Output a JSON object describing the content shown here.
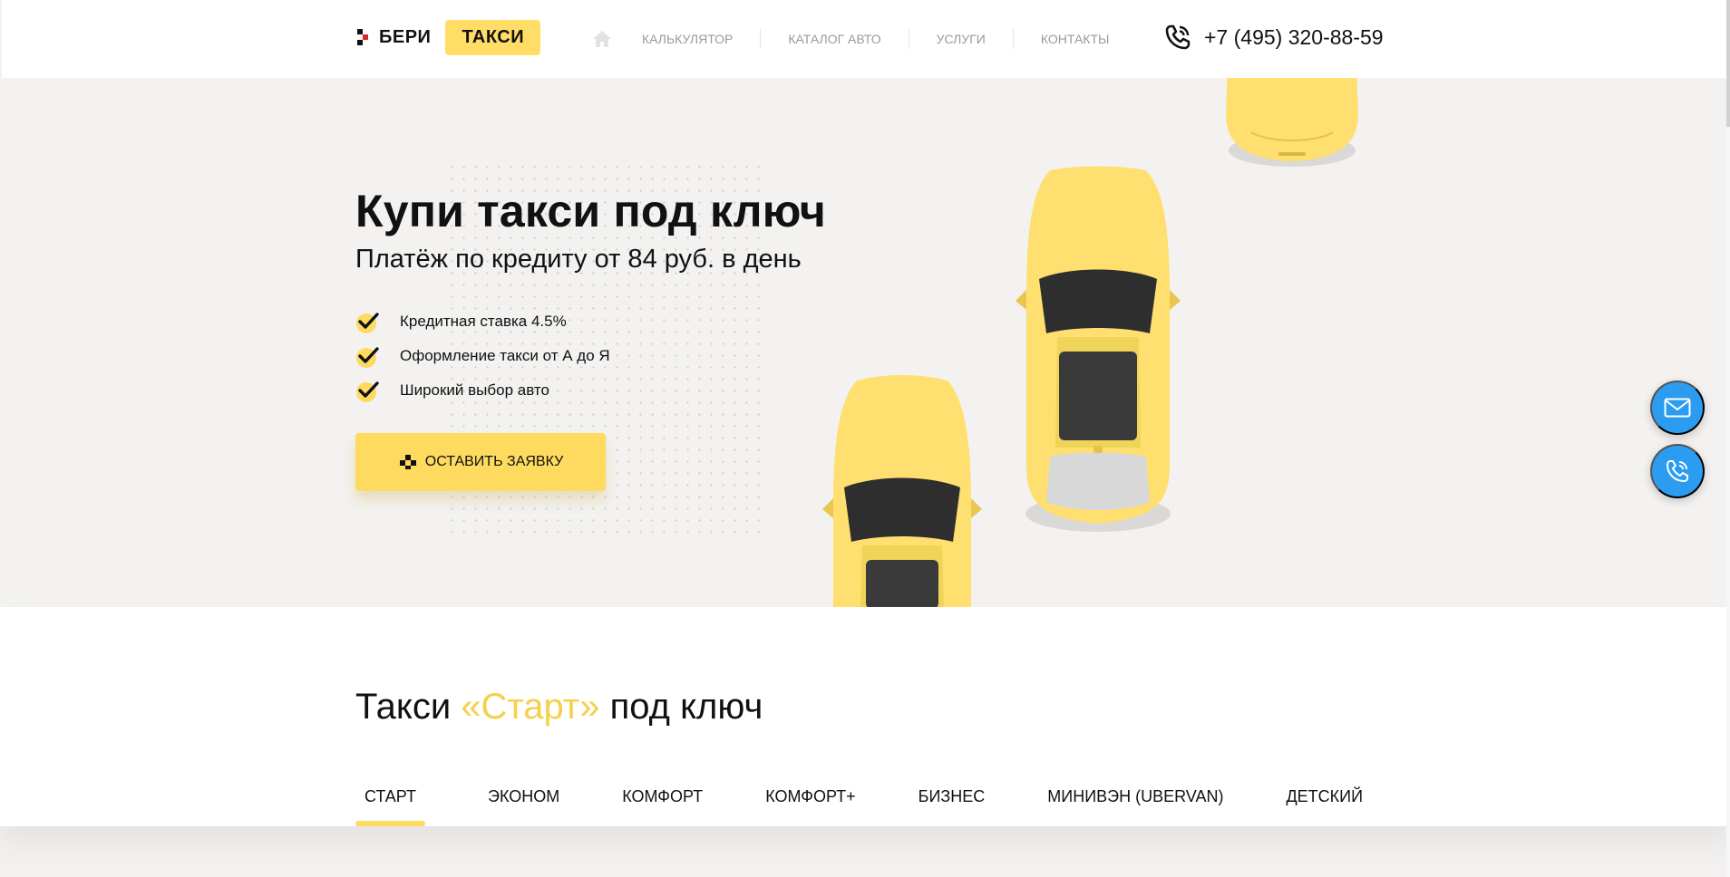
{
  "header": {
    "logo": {
      "left": "БЕРИ",
      "right": "ТАКСИ"
    },
    "nav": [
      {
        "label": "КАЛЬКУЛЯТОР"
      },
      {
        "label": "КАТАЛОГ АВТО"
      },
      {
        "label": "УСЛУГИ"
      },
      {
        "label": "КОНТАКТЫ"
      }
    ],
    "phone": "+7 (495) 320-88-59"
  },
  "hero": {
    "title": "Купи такси под ключ",
    "subtitle": "Платёж по кредиту от 84 руб. в день",
    "features": [
      "Кредитная ставка 4.5%",
      "Оформление такси от А до Я",
      "Широкий выбор авто"
    ],
    "cta": "ОСТАВИТЬ ЗАЯВКУ"
  },
  "section": {
    "title_before": "Такси ",
    "title_accent": "«Старт»",
    "title_after": " под ключ",
    "tabs": [
      {
        "label": "СТАРТ",
        "active": true
      },
      {
        "label": "ЭКОНОМ"
      },
      {
        "label": "КОМФОРТ"
      },
      {
        "label": "КОМФОРТ+"
      },
      {
        "label": "БИЗНЕС"
      },
      {
        "label": "МИНИВЭН (UBERVAN)"
      },
      {
        "label": "ДЕТСКИЙ"
      }
    ]
  },
  "colors": {
    "accent": "#fedb5f",
    "fab": "#2c9cf0",
    "hero_bg": "#f3f2f0"
  },
  "icons": {
    "home": "home-icon",
    "phone": "phone-icon",
    "check": "check-icon",
    "cta": "checker-icon",
    "mail": "mail-icon",
    "call": "call-icon"
  }
}
